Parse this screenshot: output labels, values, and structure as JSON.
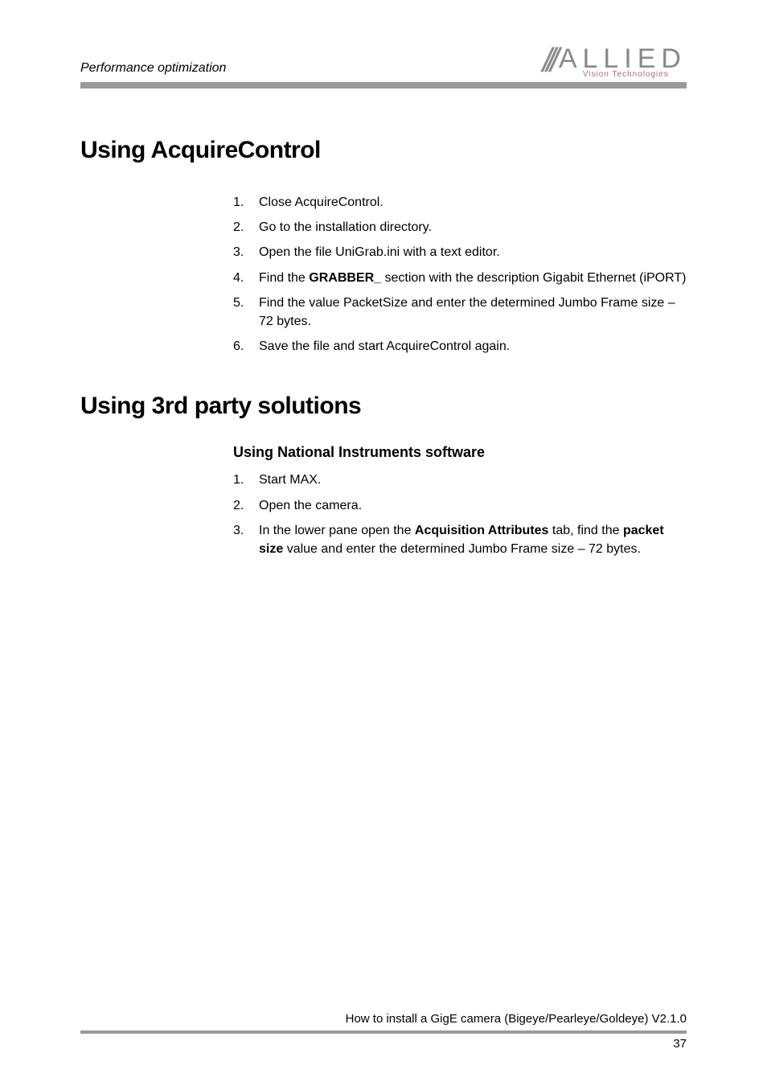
{
  "header": {
    "running_head": "Performance optimization",
    "logo_main": "ALLIED",
    "logo_sub": "Vision Technologies"
  },
  "section1": {
    "title": "Using AcquireControl",
    "items": [
      {
        "num": "1.",
        "text": "Close AcquireControl."
      },
      {
        "num": "2.",
        "text": "Go to the installation directory."
      },
      {
        "num": "3.",
        "text": "Open the file UniGrab.ini with a text editor."
      },
      {
        "num": "4.",
        "pre": "Find the ",
        "bold": "GRABBER_",
        "post": " section with the description Gigabit Ethernet (iPORT)"
      },
      {
        "num": "5.",
        "text": "Find the value PacketSize and enter the determined Jumbo Frame size – 72 bytes."
      },
      {
        "num": "6.",
        "text": "Save the file and start AcquireControl again."
      }
    ]
  },
  "section2": {
    "title": "Using 3rd party solutions",
    "subhead": "Using National Instruments software",
    "items": [
      {
        "num": "1.",
        "text": "Start MAX."
      },
      {
        "num": "2.",
        "text": "Open the camera."
      },
      {
        "num": "3.",
        "pre": "In the lower pane open the ",
        "bold1": "Acquisition Attributes",
        "mid": " tab, find the ",
        "bold2": "packet size",
        "post": " value and enter the determined Jumbo Frame size – 72 bytes."
      }
    ]
  },
  "footer": {
    "text": "How to install a GigE camera (Bigeye/Pearleye/Goldeye) V2.1.0",
    "page": "37"
  }
}
